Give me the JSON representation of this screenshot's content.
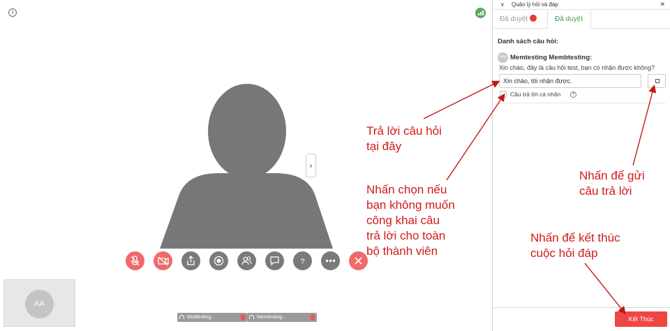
{
  "stage": {
    "self_initials": "AA",
    "participants": [
      {
        "name": "Modtesting..."
      },
      {
        "name": "Memtesting..."
      }
    ],
    "controls": [
      {
        "icon": "mic-off-icon",
        "state": "off"
      },
      {
        "icon": "camera-off-icon",
        "state": "off"
      },
      {
        "icon": "share-screen-icon"
      },
      {
        "icon": "record-icon"
      },
      {
        "icon": "participants-icon"
      },
      {
        "icon": "chat-icon"
      },
      {
        "icon": "help-icon",
        "glyph": "?"
      },
      {
        "icon": "more-icon"
      },
      {
        "icon": "leave-call-icon"
      }
    ]
  },
  "panel": {
    "title": "Quản lý hỏi và đáp",
    "tabs": [
      {
        "label": "Đã duyệt",
        "badge": true,
        "active": false
      },
      {
        "label": "Đã duyệt",
        "active": true
      }
    ],
    "section_title": "Danh sách câu hỏi:",
    "question": {
      "author_initials": "MM",
      "author": "Memtesting Membtesting:",
      "text": "Xin chào, đây là câu hỏi test, bạn có nhận được không?",
      "answer_value": "Xin chào, tôi nhận được.",
      "private_label": "Câu trả lời cá nhân",
      "private_checked": false
    },
    "end_button": "Kết Thúc"
  },
  "annotations": {
    "answer_here": [
      "Trả lời câu hỏi",
      "tại đây"
    ],
    "private_hint": [
      "Nhấn chọn nếu",
      "bạn không muốn",
      "công khai câu",
      "trả lời cho toàn",
      "bộ thành viên"
    ],
    "send_hint": [
      "Nhấn để gửi",
      "câu trả lời"
    ],
    "end_hint": [
      "Nhấn để kết thúc",
      "cuộc hỏi đáp"
    ],
    "color": "#d11a1a"
  },
  "colors": {
    "accent_green": "#4a9a4a",
    "danger": "#ee4545"
  }
}
